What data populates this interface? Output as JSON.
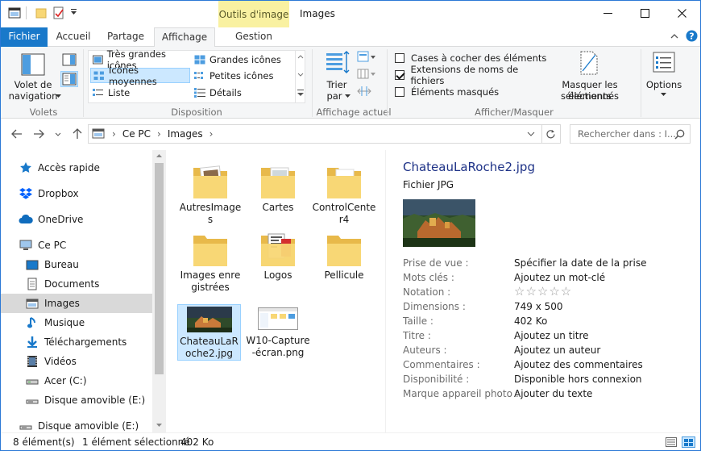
{
  "window": {
    "title": "Images",
    "context_tab": "Outils d'image"
  },
  "tabs": {
    "fichier": "Fichier",
    "accueil": "Accueil",
    "partage": "Partage",
    "affichage": "Affichage",
    "gestion": "Gestion"
  },
  "ribbon": {
    "volets": {
      "nav_pane_line1": "Volet de",
      "nav_pane_line2": "navigation",
      "label": "Volets"
    },
    "disposition": {
      "items": [
        "Très grandes icônes",
        "Grandes icônes",
        "Icônes moyennes",
        "Petites icônes",
        "Liste",
        "Détails"
      ],
      "selected": "Icônes moyennes",
      "label": "Disposition"
    },
    "affichage_actuel": {
      "sort_line1": "Trier",
      "sort_line2": "par",
      "label": "Affichage actuel"
    },
    "afficher_masquer": {
      "checkboxes": [
        {
          "label": "Cases à cocher des éléments",
          "checked": false
        },
        {
          "label": "Extensions de noms de fichiers",
          "checked": true
        },
        {
          "label": "Éléments masqués",
          "checked": false
        }
      ],
      "hide_line1": "Masquer les éléments",
      "hide_line2": "sélectionnés",
      "label": "Afficher/Masquer"
    },
    "options": "Options"
  },
  "address": {
    "path": [
      "Ce PC",
      "Images"
    ],
    "search_placeholder": "Rechercher dans : I..."
  },
  "nav": [
    {
      "label": "Accès rapide",
      "icon": "star-icon",
      "level": 0
    },
    {
      "label": "Dropbox",
      "icon": "dropbox-icon",
      "level": 0
    },
    {
      "label": "OneDrive",
      "icon": "cloud-icon",
      "level": 0
    },
    {
      "label": "Ce PC",
      "icon": "computer-icon",
      "level": 0
    },
    {
      "label": "Bureau",
      "icon": "desktop-icon",
      "level": 1
    },
    {
      "label": "Documents",
      "icon": "documents-icon",
      "level": 1
    },
    {
      "label": "Images",
      "icon": "pictures-icon",
      "level": 1,
      "selected": true
    },
    {
      "label": "Musique",
      "icon": "music-icon",
      "level": 1
    },
    {
      "label": "Téléchargements",
      "icon": "download-icon",
      "level": 1
    },
    {
      "label": "Vidéos",
      "icon": "video-icon",
      "level": 1
    },
    {
      "label": "Acer (C:)",
      "icon": "drive-icon",
      "level": 1
    },
    {
      "label": "Disque amovible (E:)",
      "icon": "removable-drive-icon",
      "level": 1
    },
    {
      "label": "Disque amovible (E:)",
      "icon": "removable-drive-icon",
      "level": 0
    }
  ],
  "files": [
    {
      "name": "AutresImages",
      "type": "folder"
    },
    {
      "name": "Cartes",
      "type": "folder"
    },
    {
      "name": "ControlCenter4",
      "type": "folder"
    },
    {
      "name": "Images enregistrées",
      "type": "folder"
    },
    {
      "name": "Logos",
      "type": "folder"
    },
    {
      "name": "Pellicule",
      "type": "folder"
    },
    {
      "name": "ChateauLaRoche2.jpg",
      "type": "image",
      "selected": true
    },
    {
      "name": "W10-Capture-écran.png",
      "type": "screenshot"
    }
  ],
  "details": {
    "filename": "ChateauLaRoche2.jpg",
    "filetype": "Fichier JPG",
    "properties": [
      {
        "key": "Prise de vue :",
        "value": "Spécifier la date de la prise"
      },
      {
        "key": "Mots clés :",
        "value": "Ajoutez un mot-clé"
      },
      {
        "key": "Notation :",
        "value": "☆☆☆☆☆"
      },
      {
        "key": "Dimensions :",
        "value": "749 x 500"
      },
      {
        "key": "Taille :",
        "value": "402 Ko"
      },
      {
        "key": "Titre :",
        "value": "Ajoutez un titre"
      },
      {
        "key": "Auteurs :",
        "value": "Ajoutez un auteur"
      },
      {
        "key": "Commentaires :",
        "value": "Ajoutez des commentaires"
      },
      {
        "key": "Disponibilité :",
        "value": "Disponible hors connexion"
      },
      {
        "key": "Marque appareil photo :",
        "value": "Ajouter du texte"
      }
    ]
  },
  "status": {
    "count": "8 élément(s)",
    "selection": "1 élément sélectionné",
    "size": "402 Ko"
  },
  "colors": {
    "accent": "#1979ca",
    "selection": "#cce8ff",
    "context_tab": "#f9f1a1",
    "folder": "#f8d775"
  }
}
